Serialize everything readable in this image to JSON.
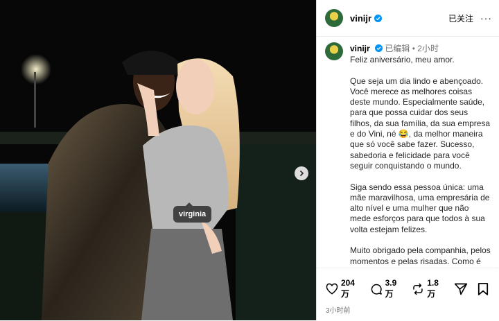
{
  "post": {
    "username": "vinijr",
    "follow_label": "已关注",
    "more_label": "···",
    "edited_label": "已编辑",
    "time_short": "2小时",
    "tag_label": "virginia",
    "caption": "Feliz aniversário, meu amor.\n\nQue seja um dia lindo e abençoado. Você merece as melhores coisas deste mundo. Especialmente saúde, para que possa cuidar dos seus filhos, da sua família, da sua empresa e do Vini, né 😂, da melhor maneira que só você sabe fazer. Sucesso, sabedoria e felicidade para você seguir conquistando o mundo.\n\nSiga sendo essa pessoa única: uma mãe maravilhosa, uma empresária de alto nível e uma mulher que não mede esforços para que todos à sua volta estejam felizes.\n\nMuito obrigado pela companhia, pelos momentos e pelas risadas. Como é bom te ter por perto.",
    "likes": "204 万",
    "comments": "3.9 万",
    "reposts": "1.8 万",
    "time_ago": "3小时前"
  },
  "icons": {
    "verified": "verified-badge-icon",
    "like": "heart-icon",
    "comment": "comment-icon",
    "repost": "repost-icon",
    "share": "share-icon",
    "save": "bookmark-icon",
    "next": "chevron-right-icon"
  },
  "colors": {
    "verified": "#0095f6",
    "muted": "#737373"
  }
}
